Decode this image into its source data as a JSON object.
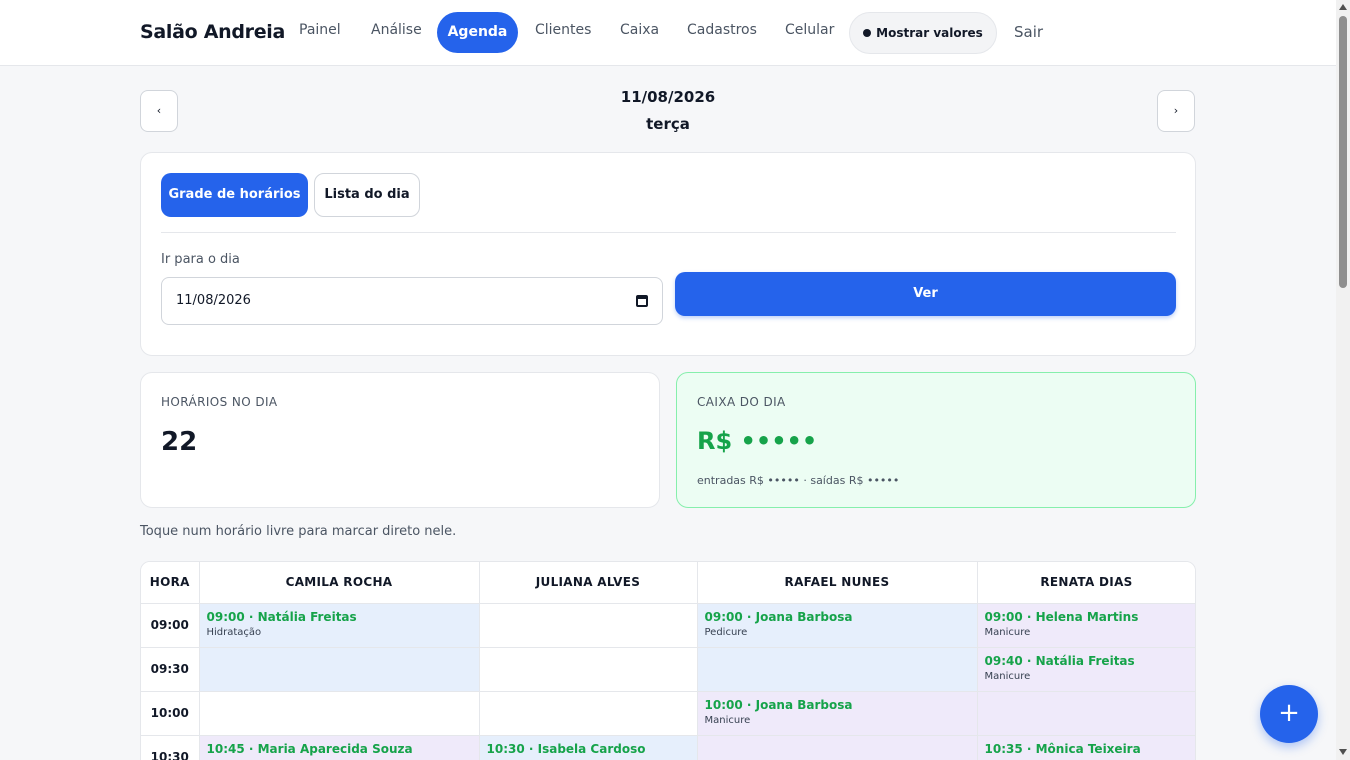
{
  "nav": {
    "brand": "Salão Andreia",
    "items": [
      "Painel",
      "Análise",
      "Agenda",
      "Clientes",
      "Caixa",
      "Cadastros",
      "Celular"
    ],
    "active": "Agenda",
    "show_values": "Mostrar valores",
    "logout": "Sair"
  },
  "date_header": {
    "prev": "‹",
    "next": "›",
    "date": "11/08/2026",
    "weekday": "terça"
  },
  "controls": {
    "tab_grid": "Grade de horários",
    "tab_list": "Lista do dia",
    "goto_label": "Ir para o dia",
    "date_value": "11/08/2026",
    "submit": "Ver"
  },
  "stats": {
    "slots_label": "HORÁRIOS NO DIA",
    "slots_value": "22",
    "cash_label": "CAIXA DO DIA",
    "cash_value": "R$ •••••",
    "cash_sub": "entradas R$ ••••• · saídas R$ •••••"
  },
  "hint": "Toque num horário livre para marcar direto nele.",
  "schedule": {
    "columns": [
      "HORA",
      "CAMILA ROCHA",
      "JULIANA ALVES",
      "RAFAEL NUNES",
      "RENATA DIAS"
    ],
    "rows": [
      {
        "hour": "09:00",
        "cells": [
          {
            "tone": "blue",
            "title": "09:00 · Natália Freitas",
            "service": "Hidratação"
          },
          {
            "tone": "",
            "title": "",
            "service": ""
          },
          {
            "tone": "blue",
            "title": "09:00 · Joana Barbosa",
            "service": "Pedicure"
          },
          {
            "tone": "purple",
            "title": "09:00 · Helena Martins",
            "service": "Manicure"
          }
        ]
      },
      {
        "hour": "09:30",
        "cells": [
          {
            "tone": "blue",
            "title": "",
            "service": ""
          },
          {
            "tone": "",
            "title": "",
            "service": ""
          },
          {
            "tone": "blue",
            "title": "",
            "service": ""
          },
          {
            "tone": "purple",
            "title": "09:40 · Natália Freitas",
            "service": "Manicure"
          }
        ]
      },
      {
        "hour": "10:00",
        "cells": [
          {
            "tone": "",
            "title": "",
            "service": ""
          },
          {
            "tone": "",
            "title": "",
            "service": ""
          },
          {
            "tone": "purple",
            "title": "10:00 · Joana Barbosa",
            "service": "Manicure"
          },
          {
            "tone": "purple",
            "title": "",
            "service": ""
          }
        ]
      },
      {
        "hour": "10:30",
        "cells": [
          {
            "tone": "purple",
            "title": "10:45 · Maria Aparecida Souza",
            "service": ""
          },
          {
            "tone": "blue",
            "title": "10:30 · Isabela Cardoso",
            "service": ""
          },
          {
            "tone": "purple",
            "title": "",
            "service": ""
          },
          {
            "tone": "purple",
            "title": "10:35 · Mônica Teixeira",
            "service": ""
          }
        ]
      }
    ]
  },
  "fab": "+",
  "colors": {
    "accent": "#2563eb",
    "success": "#16a34a",
    "cash_bg": "#ecfdf3",
    "cell_blue": "#e6effc",
    "cell_purple": "#efeafa"
  }
}
